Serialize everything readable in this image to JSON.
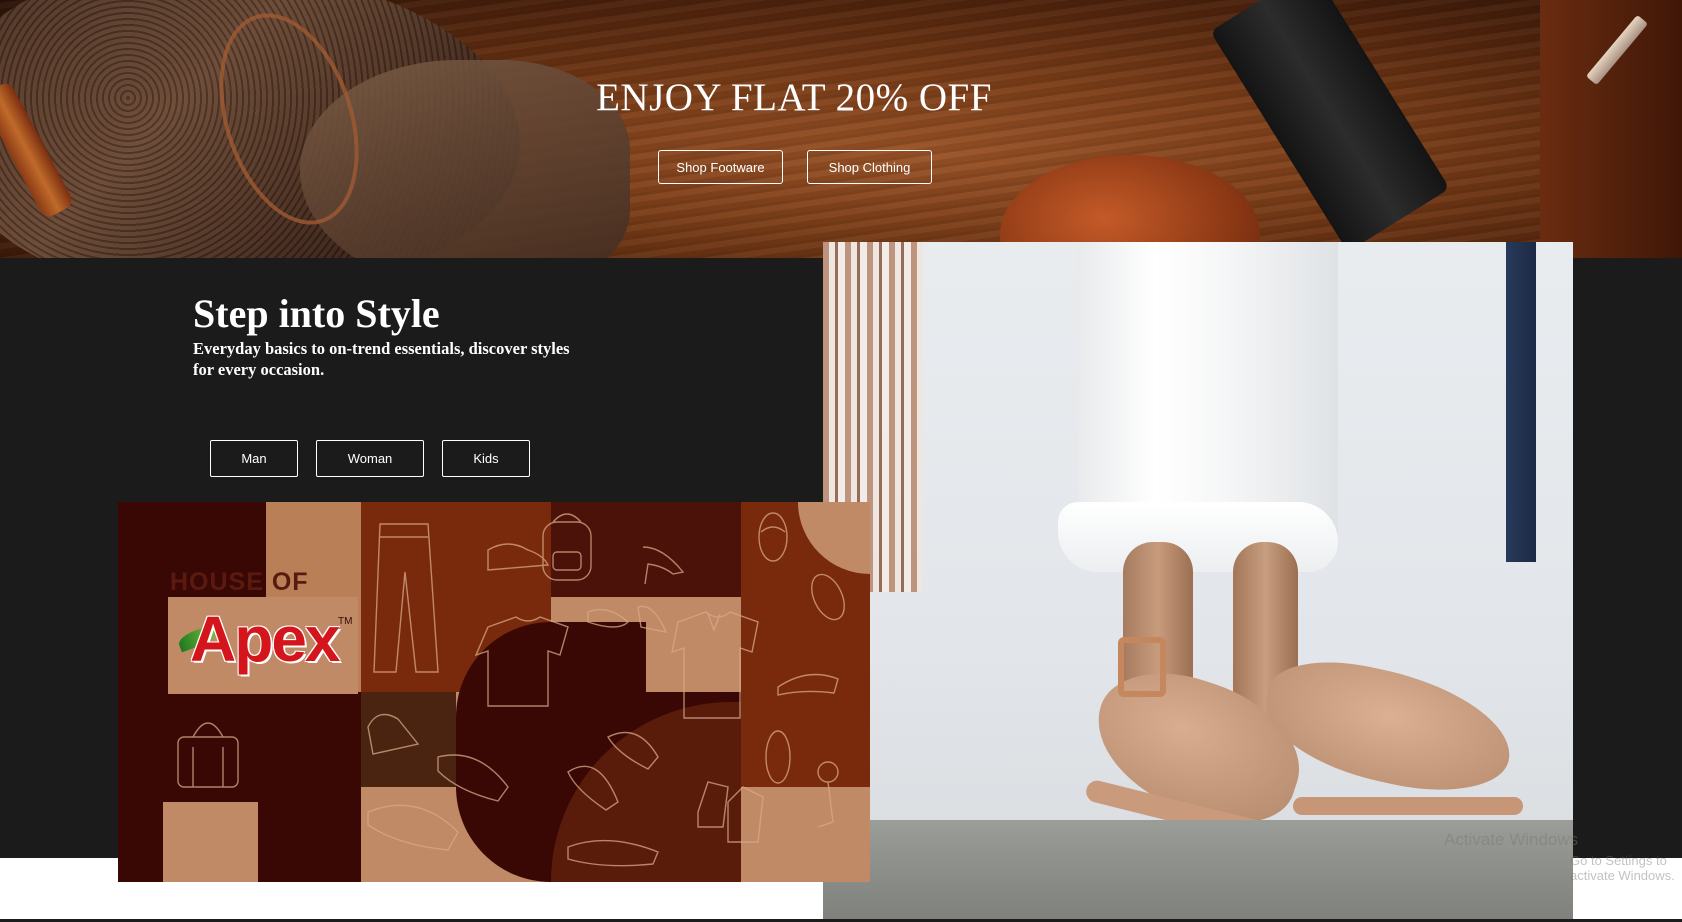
{
  "hero": {
    "title": "ENJOY FLAT 20% OFF",
    "buttons": [
      "Shop Footware",
      "Shop Clothing"
    ]
  },
  "intro": {
    "title": "Step into Style",
    "subtitle": "Everyday basics to on-trend essentials, discover styles for every occasion."
  },
  "categories": [
    "Man",
    "Woman",
    "Kids"
  ],
  "banner": {
    "brand_prefix": "HOUSE OF",
    "brand_name": "Apex",
    "trademark": "TM"
  },
  "watermark": {
    "line1": "Activate Windows",
    "line2": "Go to Settings to activate Windows."
  },
  "colors": {
    "dark_bg": "#1b1b1c",
    "banner_maroon": "#2e0604",
    "banner_rust": "#7a2a0c",
    "banner_tan": "#c08a66",
    "apex_red": "#d4151c"
  }
}
